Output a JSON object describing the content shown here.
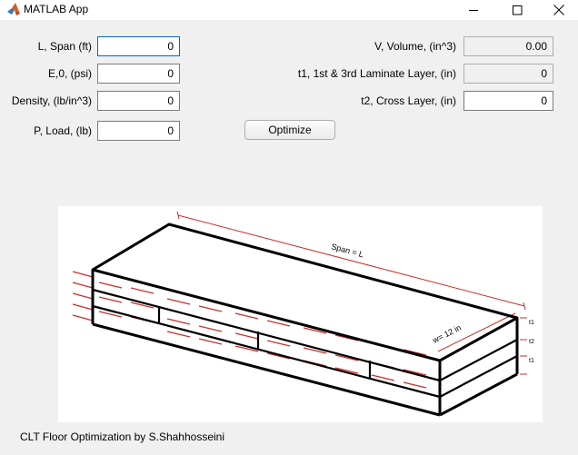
{
  "window": {
    "title": "MATLAB App"
  },
  "inputs": [
    {
      "label": "L, Span (ft)",
      "value": "0"
    },
    {
      "label": "E,0, (psi)",
      "value": "0"
    },
    {
      "label": "Density, (lb/in^3)",
      "value": "0"
    },
    {
      "label": "P, Load, (lb)",
      "value": "0"
    }
  ],
  "outputs": [
    {
      "label": "V, Volume, (in^3)",
      "value": "0.00"
    },
    {
      "label": "t1, 1st & 3rd Laminate Layer, (in)",
      "value": "0"
    },
    {
      "label": "t2, Cross Layer, (in)",
      "value": "0"
    }
  ],
  "optimize_button": "Optimize",
  "diagram": {
    "span_label": "Span = L",
    "width_label": "w= 12 in",
    "layer_labels": [
      "t1",
      "t2",
      "t1"
    ]
  },
  "footer": "CLT Floor Optimization by S.Shahhosseini"
}
